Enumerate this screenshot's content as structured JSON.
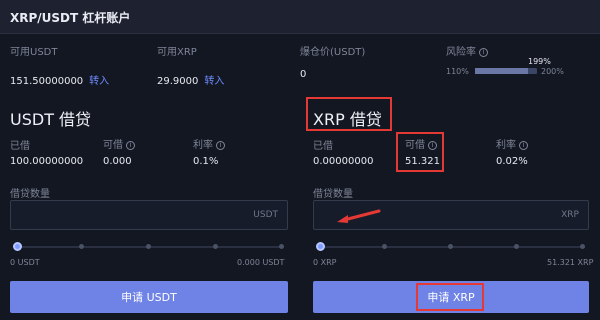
{
  "header": {
    "title": "XRP/USDT 杠杆账户"
  },
  "account": {
    "usdt_label": "可用USDT",
    "usdt_value": "151.50000000",
    "usdt_transfer": "转入",
    "xrp_label": "可用XRP",
    "xrp_value": "29.9000",
    "xrp_transfer": "转入",
    "liq_label": "爆仓价(USDT)",
    "liq_value": "0",
    "risk_label": "风险率",
    "risk_min": "110%",
    "risk_current": "199%",
    "risk_max": "200%",
    "risk_fill_fraction": 0.86
  },
  "usdt_loan": {
    "title": "USDT 借贷",
    "borrowed_label": "已借",
    "borrowed_value": "100.00000000",
    "available_label": "可借",
    "available_value": "0.000",
    "rate_label": "利率",
    "rate_value": "0.1%",
    "amount_label": "借贷数量",
    "amount_placeholder": "",
    "unit": "USDT",
    "slider_min": "0 USDT",
    "slider_max": "0.000 USDT",
    "button": "申请 USDT"
  },
  "xrp_loan": {
    "title": "XRP 借贷",
    "borrowed_label": "已借",
    "borrowed_value": "0.00000000",
    "available_label": "可借",
    "available_value": "51.321",
    "rate_label": "利率",
    "rate_value": "0.02%",
    "amount_label": "借贷数量",
    "amount_placeholder": "",
    "unit": "XRP",
    "slider_min": "0 XRP",
    "slider_max": "51.321 XRP",
    "button": "申请 XRP"
  },
  "colors": {
    "accent": "#6f83e7",
    "annotation": "#e53935"
  }
}
